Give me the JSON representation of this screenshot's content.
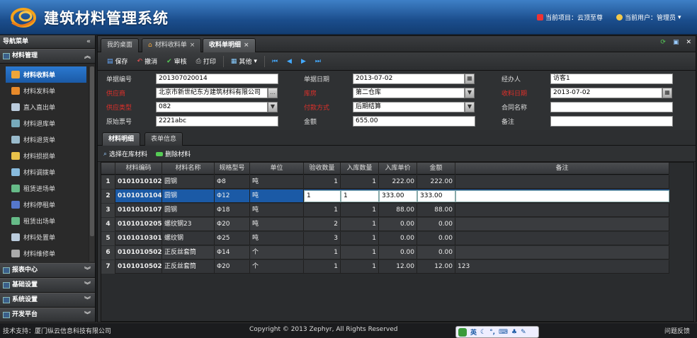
{
  "header": {
    "app_title": "建筑材料管理系统",
    "current_project": "当前项目：云顶至尊",
    "current_user": "当前用户：管理员"
  },
  "sidebar": {
    "title": "导航菜单",
    "groups": [
      {
        "label": "材料管理",
        "expanded": true
      },
      {
        "label": "报表中心"
      },
      {
        "label": "基础设置"
      },
      {
        "label": "系统设置"
      },
      {
        "label": "开发平台"
      }
    ],
    "items": [
      {
        "label": "材料收料单",
        "selected": true,
        "icon": "home-icon"
      },
      {
        "label": "材料发料单",
        "icon": "home-icon"
      },
      {
        "label": "直入直出单",
        "icon": "document-icon"
      },
      {
        "label": "材料退库单",
        "icon": "list-icon"
      },
      {
        "label": "材料退货单",
        "icon": "list-icon"
      },
      {
        "label": "材料损损单",
        "icon": "folder-icon"
      },
      {
        "label": "材料调拨单",
        "icon": "transfer-icon"
      },
      {
        "label": "租赁进场单",
        "icon": "chart-icon"
      },
      {
        "label": "材料停租单",
        "icon": "pause-icon"
      },
      {
        "label": "租赁出场单",
        "icon": "chart-icon"
      },
      {
        "label": "材料处置单",
        "icon": "document-icon"
      },
      {
        "label": "材料维修单",
        "icon": "wrench-icon"
      }
    ]
  },
  "tabs": [
    {
      "label": "我的桌面"
    },
    {
      "label": "材料收料单"
    },
    {
      "label": "收料单明细",
      "active": true
    }
  ],
  "toolbar": {
    "save": "保存",
    "cancel": "撤消",
    "audit": "审核",
    "print": "打印",
    "other": "其他"
  },
  "form": {
    "doc_no_label": "单据编号",
    "doc_no": "201307020014",
    "doc_date_label": "单据日期",
    "doc_date": "2013-07-02",
    "handler_label": "经办人",
    "handler": "访客1",
    "supplier_label": "供应商",
    "supplier": "北京市新世纪东方建筑材料有限公司",
    "warehouse_label": "库房",
    "warehouse": "第二仓库",
    "receive_date_label": "收料日期",
    "receive_date": "2013-07-02",
    "supplier_type_label": "供应类型",
    "supplier_type": "082",
    "payment_label": "付款方式",
    "payment": "后期结算",
    "contract_label": "合同名称",
    "contract": "",
    "orig_no_label": "原始票号",
    "orig_no": "2221abc",
    "amount_label": "金额",
    "amount": "655.00",
    "remark_label": "备注",
    "remark": ""
  },
  "subtabs": [
    {
      "label": "材料明细",
      "active": true
    },
    {
      "label": "表单信息"
    }
  ],
  "grid_toolbar": {
    "select": "选择在库材料",
    "delete": "删除材料"
  },
  "grid": {
    "headers": [
      "",
      "材料编码",
      "材料名称",
      "规格型号",
      "单位",
      "验收数量",
      "入库数量",
      "入库单价",
      "金额",
      "备注"
    ],
    "rows": [
      [
        "1",
        "0101010102",
        "圆钢",
        "Φ8",
        "吨",
        "1",
        "1",
        "222.00",
        "222.00",
        ""
      ],
      [
        "2",
        "0101010104",
        "圆钢",
        "Φ12",
        "吨",
        "1",
        "1",
        "333.00",
        "333.00",
        ""
      ],
      [
        "3",
        "0101010107",
        "圆钢",
        "Φ18",
        "吨",
        "1",
        "1",
        "88.00",
        "88.00",
        ""
      ],
      [
        "4",
        "0101010205",
        "螺纹钢23",
        "Φ20",
        "吨",
        "2",
        "1",
        "0.00",
        "0.00",
        ""
      ],
      [
        "5",
        "0101010301",
        "螺纹钢",
        "Φ25",
        "吨",
        "3",
        "1",
        "0.00",
        "0.00",
        ""
      ],
      [
        "6",
        "0101010502",
        "正反丝套筒",
        "Φ14",
        "个",
        "1",
        "1",
        "0.00",
        "0.00",
        ""
      ],
      [
        "7",
        "0101010502",
        "正反丝套筒",
        "Φ20",
        "个",
        "1",
        "1",
        "12.00",
        "12.00",
        "123"
      ]
    ],
    "editing_row": 1
  },
  "footer": {
    "support": "技术支持：厦门纵云信息科技有限公司",
    "copyright": "Copyright © 2013 Zephyr, All Rights Reserved",
    "ime_lang": "英",
    "feedback": "问题反馈"
  }
}
